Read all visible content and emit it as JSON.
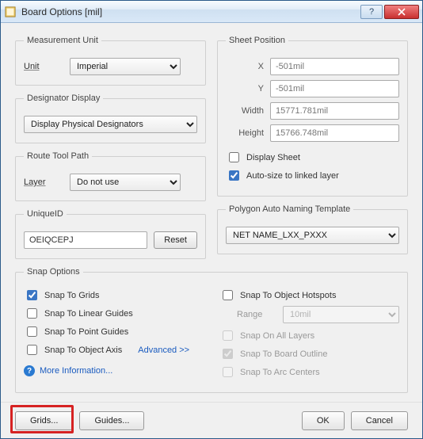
{
  "window": {
    "title": "Board Options [mil]"
  },
  "measurement": {
    "legend": "Measurement Unit",
    "unit_label": "Unit",
    "unit_value": "Imperial"
  },
  "designator": {
    "legend": "Designator Display",
    "value": "Display Physical Designators"
  },
  "route": {
    "legend": "Route Tool Path",
    "layer_label": "Layer",
    "layer_value": "Do not use"
  },
  "uniqueid": {
    "legend": "UniqueID",
    "value": "OEIQCEPJ",
    "reset": "Reset"
  },
  "sheet": {
    "legend": "Sheet Position",
    "x_label": "X",
    "x_value": "-501mil",
    "y_label": "Y",
    "y_value": "-501mil",
    "width_label": "Width",
    "width_value": "15771.781mil",
    "height_label": "Height",
    "height_value": "15766.748mil",
    "display_sheet": "Display Sheet",
    "autosize": "Auto-size to linked layer"
  },
  "polygon": {
    "legend": "Polygon Auto Naming Template",
    "value": "NET NAME_LXX_PXXX"
  },
  "snap": {
    "legend": "Snap Options",
    "to_grids": "Snap To Grids",
    "to_linear": "Snap To Linear Guides",
    "to_point": "Snap To Point Guides",
    "to_axis": "Snap To Object Axis",
    "advanced": "Advanced >>",
    "more_info": "More Information...",
    "to_hotspots": "Snap To Object Hotspots",
    "range_label": "Range",
    "range_value": "10mil",
    "on_all_layers": "Snap On All Layers",
    "to_board_outline": "Snap To Board Outline",
    "to_arc_centers": "Snap To Arc Centers"
  },
  "footer": {
    "grids": "Grids...",
    "guides": "Guides...",
    "ok": "OK",
    "cancel": "Cancel"
  }
}
